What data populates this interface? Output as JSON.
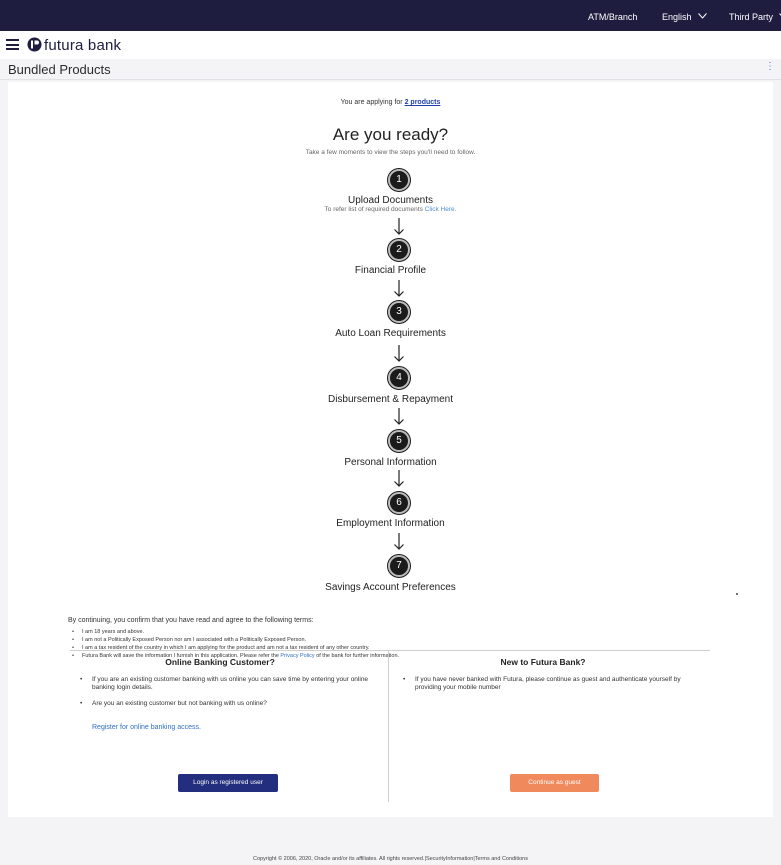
{
  "topbar": {
    "atm_branch": "ATM/Branch",
    "language": "English",
    "third_party": "Third Party"
  },
  "header": {
    "brand": "futura bank"
  },
  "page": {
    "title": "Bundled Products"
  },
  "intro": {
    "applying_prefix": "You are applying for",
    "applying_link": "2 products",
    "heading": "Are you ready?",
    "subheading": "Take a few moments to view the steps you'll need to follow."
  },
  "steps": [
    {
      "number": "1",
      "title": "Upload Documents",
      "sub_prefix": "To refer list of required documents",
      "sub_link": "Click Here."
    },
    {
      "number": "2",
      "title": "Financial Profile"
    },
    {
      "number": "3",
      "title": "Auto Loan Requirements"
    },
    {
      "number": "4",
      "title": "Disbursement & Repayment"
    },
    {
      "number": "5",
      "title": "Personal Information"
    },
    {
      "number": "6",
      "title": "Employment Information"
    },
    {
      "number": "7",
      "title": "Savings Account Preferences"
    }
  ],
  "terms": {
    "lead": "By continuing, you confirm that you have read and agree to the following terms:",
    "items": [
      "I am 18 years and above.",
      "I am not a Politically Exposed Person nor am I associated with a Politically Exposed Person.",
      "I am a tax resident of the country in which I am applying for the product and am not a tax resident of any other country."
    ],
    "privacy_prefix": "Futura Bank will save the information I furnish in this application. Please refer the",
    "privacy_link": "Privacy Policy",
    "privacy_suffix": "of the bank for further information."
  },
  "online_panel": {
    "title": "Online Banking Customer?",
    "item1": "If you are an existing customer banking with us online you can save time by entering your online banking login details.",
    "item2": "Are you an existing customer but not banking with us online?",
    "register_link": "Register for online banking access.",
    "button": "Login as registered user"
  },
  "new_panel": {
    "title": "New to Futura Bank?",
    "item1": "If you have never banked with Futura, please continue as guest and authenticate yourself by providing your mobile number",
    "button": "Continue as guest"
  },
  "footer": {
    "copyright": "Copyright © 2006, 2020, Oracle and/or its affiliates. All rights reserved.|SecurityInformation|Terms and Conditions"
  },
  "colors": {
    "topbar": "#1f1d3f",
    "login_button": "#232e7e",
    "guest_button": "#f08a5d",
    "link": "#2e6fc4"
  }
}
